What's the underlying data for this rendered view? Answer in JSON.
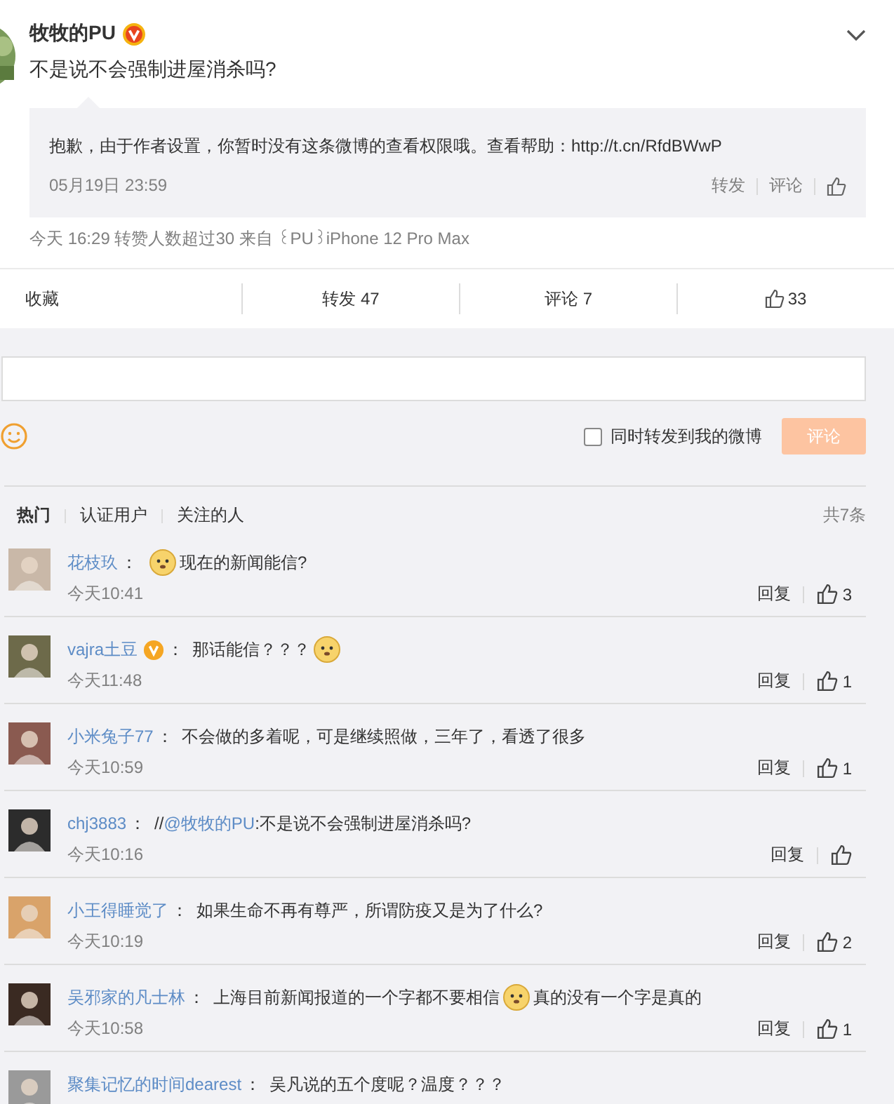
{
  "post": {
    "author": "牧牧的PU",
    "verified": true,
    "text": "不是说不会强制进屋消杀吗?",
    "repost": {
      "text": "抱歉，由于作者设置，你暂时没有这条微博的查看权限哦。查看帮助：",
      "link": "http://t.cn/RfdBWwP",
      "time": "05月19日 23:59",
      "actions": [
        "转发",
        "评论"
      ]
    },
    "meta": "今天 16:29 转赞人数超过30  来自 ꒰PU꒱iPhone 12 Pro Max"
  },
  "action_bar": {
    "favorite": "收藏",
    "repost": "转发 47",
    "comment": "评论 7",
    "like": "33"
  },
  "compose": {
    "also_repost": {
      "label": "同时转发到我的微博",
      "checked": false
    },
    "submit": {
      "label": "评论",
      "disabled": true
    }
  },
  "filters": [
    {
      "label": "热门",
      "selected": true
    },
    {
      "label": "认证用户",
      "selected": false
    },
    {
      "label": "关注的人",
      "selected": false
    }
  ],
  "total": "共7条",
  "comments": [
    {
      "name": "花枝玖",
      "verified": false,
      "sep": "：",
      "content": [
        {
          "kind": "emoji"
        },
        {
          "kind": "text",
          "text": "现在的新闻能信?"
        }
      ],
      "time": "今天10:41",
      "reply": "回复",
      "likes": "3"
    },
    {
      "name": "vajra土豆",
      "verified": true,
      "sep": "：",
      "content": [
        {
          "kind": "text",
          "text": "那话能信？？？"
        },
        {
          "kind": "emoji"
        }
      ],
      "time": "今天11:48",
      "reply": "回复",
      "likes": "1"
    },
    {
      "name": "小米兔子77",
      "verified": false,
      "sep": "：",
      "content": [
        {
          "kind": "text",
          "text": "不会做的多着呢，可是继续照做，三年了，看透了很多"
        }
      ],
      "time": "今天10:59",
      "reply": "回复",
      "likes": "1"
    },
    {
      "name": "chj3883",
      "verified": false,
      "sep": "：",
      "content": [
        {
          "kind": "text",
          "text": "//"
        },
        {
          "kind": "mention",
          "text": "@牧牧的PU"
        },
        {
          "kind": "text",
          "text": ":不是说不会强制进屋消杀吗?"
        }
      ],
      "time": "今天10:16",
      "reply": "回复"
    },
    {
      "name": "小王得睡觉了",
      "verified": false,
      "sep": "：",
      "content": [
        {
          "kind": "text",
          "text": "如果生命不再有尊严，所谓防疫又是为了什么?"
        }
      ],
      "time": "今天10:19",
      "reply": "回复",
      "likes": "2"
    },
    {
      "name": "吴邪家的凡士林",
      "verified": false,
      "sep": "：",
      "content": [
        {
          "kind": "text",
          "text": "上海目前新闻报道的一个字都不要相信"
        },
        {
          "kind": "emoji"
        },
        {
          "kind": "text",
          "text": "真的没有一个字是真的"
        }
      ],
      "time": "今天10:58",
      "reply": "回复",
      "likes": "1"
    },
    {
      "name": "聚集记忆的时间dearest",
      "verified": false,
      "sep": "：",
      "content": [
        {
          "kind": "text",
          "text": "吴凡说的五个度呢？温度？？？"
        }
      ]
    }
  ]
}
